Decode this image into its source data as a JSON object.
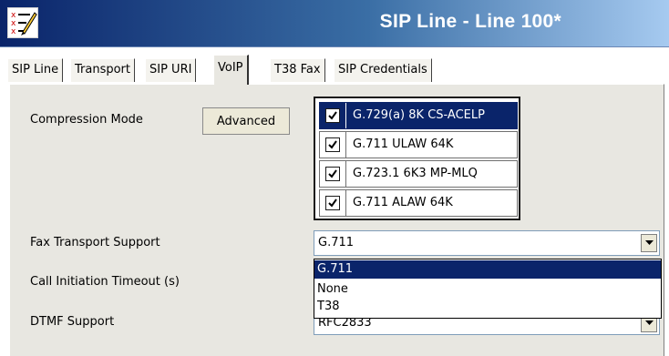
{
  "window": {
    "title": "SIP Line - Line 100*",
    "icon": "config-edit-icon",
    "title_gradient": [
      "#0a246a",
      "#a6caf0"
    ]
  },
  "tabs": [
    {
      "label": "SIP Line",
      "active": false
    },
    {
      "label": "Transport",
      "active": false
    },
    {
      "label": "SIP URI",
      "active": false
    },
    {
      "label": "VoIP",
      "active": true
    },
    {
      "label": "T38 Fax",
      "active": false
    },
    {
      "label": "SIP Credentials",
      "active": false
    }
  ],
  "voip": {
    "compression_mode": {
      "label": "Compression Mode",
      "advanced_button": "Advanced",
      "codecs": [
        {
          "label": "G.729(a) 8K CS-ACELP",
          "checked": true,
          "selected": true
        },
        {
          "label": "G.711 ULAW 64K",
          "checked": true,
          "selected": false
        },
        {
          "label": "G.723.1 6K3 MP-MLQ",
          "checked": true,
          "selected": false
        },
        {
          "label": "G.711 ALAW 64K",
          "checked": true,
          "selected": false
        }
      ]
    },
    "fax_transport": {
      "label": "Fax Transport Support",
      "value": "G.711",
      "options": [
        "G.711",
        "None",
        "T38"
      ],
      "highlighted_option": "G.711"
    },
    "call_initiation_timeout": {
      "label": "Call Initiation Timeout (s)"
    },
    "dtmf_support": {
      "label": "DTMF Support",
      "value": "RFC2833"
    }
  },
  "colors": {
    "selection": "#0a246a",
    "panel": "#e8e7e1"
  }
}
